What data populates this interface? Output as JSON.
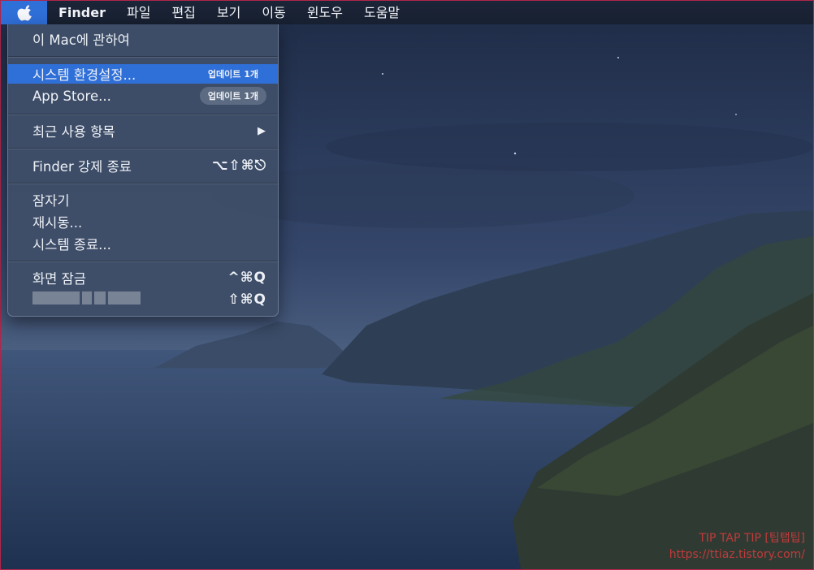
{
  "menubar": {
    "apple_icon": "apple-logo-icon",
    "app_name": "Finder",
    "items": [
      "파일",
      "편집",
      "보기",
      "이동",
      "윈도우",
      "도움말"
    ]
  },
  "apple_menu": {
    "about": "이 Mac에 관하여",
    "system_prefs": "시스템 환경설정...",
    "system_prefs_badge": "업데이트 1개",
    "app_store": "App Store...",
    "app_store_badge": "업데이트 1개",
    "recent_items": "최근 사용 항목",
    "recent_items_arrow": "▶",
    "force_quit": "Finder 강제 종료",
    "force_quit_shortcut": "⌥⇧⌘⎋",
    "sleep": "잠자기",
    "restart": "재시동...",
    "shutdown": "시스템 종료...",
    "lock_screen": "화면 잠금",
    "lock_screen_shortcut": "^⌘Q",
    "logout_shortcut": "⇧⌘Q"
  },
  "watermark": {
    "line1": "TIP TAP TIP [팁탭팁]",
    "line2": "https://ttiaz.tistory.com/"
  },
  "colors": {
    "highlight": "#2f6fd8",
    "menu_bg": "#3e4e68"
  }
}
